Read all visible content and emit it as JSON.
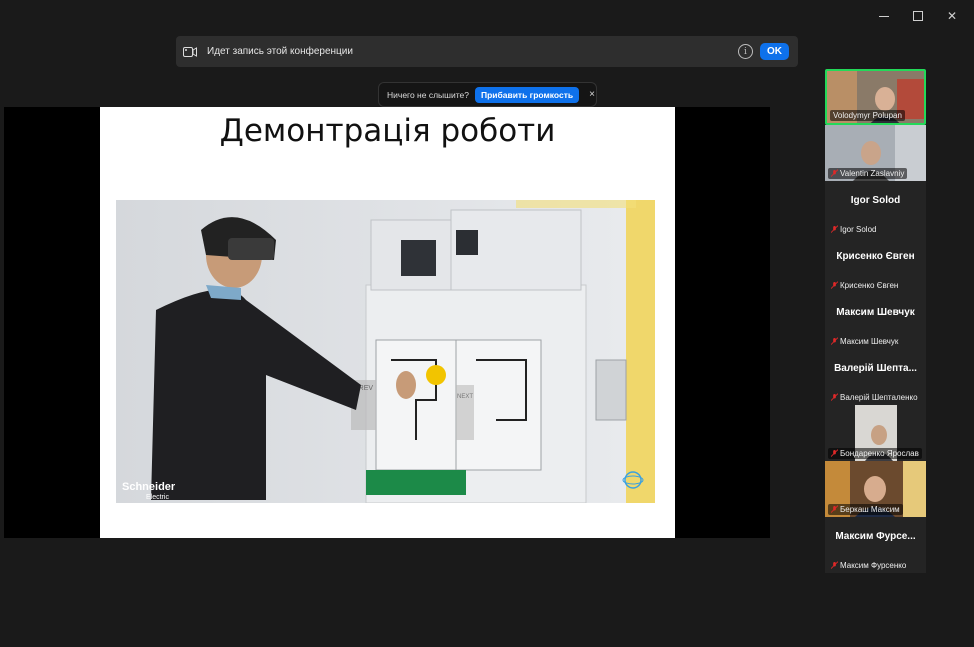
{
  "recording": {
    "text": "Идет запись этой конференции",
    "ok_label": "OK"
  },
  "audio_prompt": {
    "text": "Ничего не слышите?",
    "button_label": "Прибавить громкость",
    "close_label": "×"
  },
  "slide": {
    "title": "Демонтрація роботи",
    "photo_text": {
      "brand": "Schneider",
      "brand_sub": "Electric",
      "prev": "PREV",
      "next": "NEXT"
    }
  },
  "participants": [
    {
      "name": "Volodymyr Polupan",
      "video": true,
      "muted": false,
      "active": true
    },
    {
      "name": "Valentin Zaslavniy",
      "video": true,
      "muted": true
    },
    {
      "name": "Igor Solod",
      "display": "Igor Solod",
      "video": false,
      "muted": true
    },
    {
      "name": "Крисенко Євген",
      "display": "Крисенко Євген",
      "video": false,
      "muted": true
    },
    {
      "name": "Максим Шевчук",
      "display": "Максим Шевчук",
      "video": false,
      "muted": true
    },
    {
      "name": "Валерій Шепталенко",
      "display": "Валерій  Шепта...",
      "video": false,
      "muted": true
    },
    {
      "name": "Бондаренко Ярослав",
      "video": true,
      "muted": true
    },
    {
      "name": "Беркаш Максим",
      "video": true,
      "muted": true
    },
    {
      "name": "Максим Фурсенко",
      "display": "Максим  Фурсе...",
      "video": false,
      "muted": true
    }
  ],
  "colors": {
    "accent": "#0e71eb",
    "active_speaker": "#23d959",
    "muted_icon": "#e02828"
  }
}
